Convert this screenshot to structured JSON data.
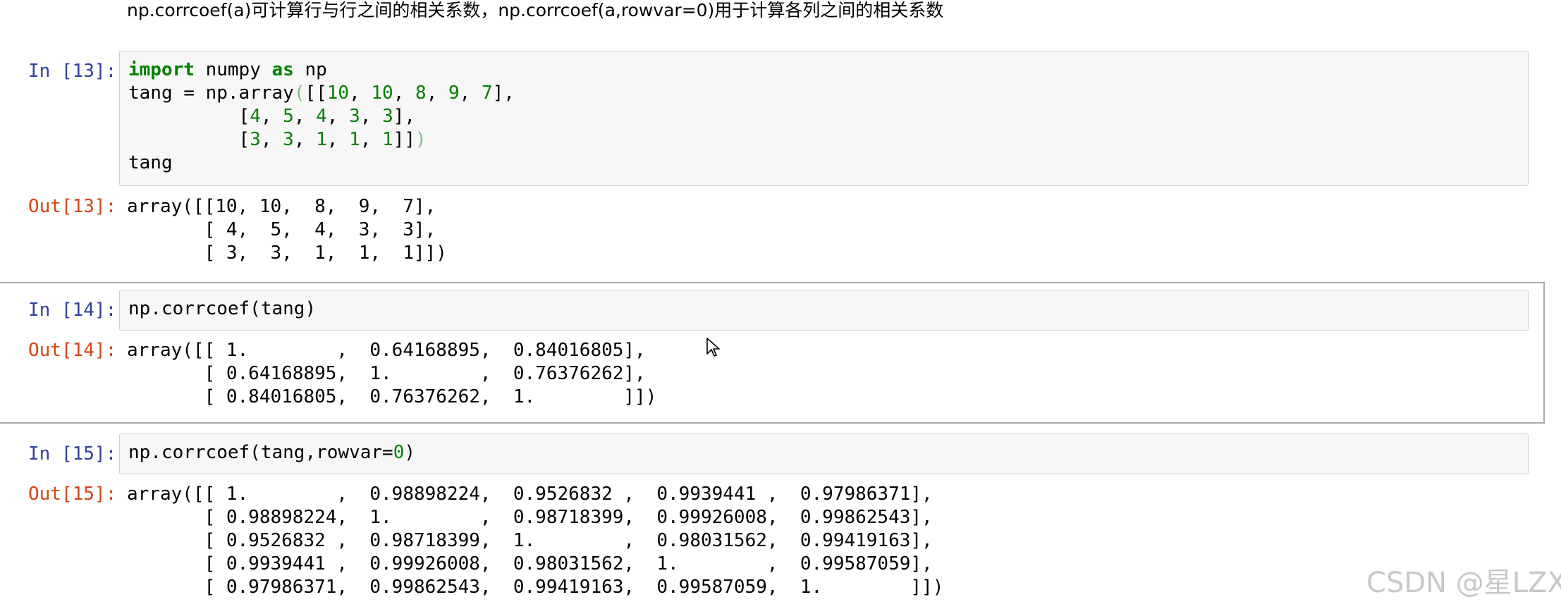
{
  "markdown": {
    "text": "np.corrcoef(a)可计算行与行之间的相关系数，np.corrcoef(a,rowvar=0)用于计算各列之间的相关系数"
  },
  "cells": [
    {
      "in_prompt": "In [13]:",
      "out_prompt": "Out[13]:",
      "input": {
        "line1_kw1": "import",
        "line1_mid": " numpy ",
        "line1_kw2": "as",
        "line1_end": " np",
        "line2_start": "tang = np.array",
        "line2_paren": "(",
        "line2_bracket": "[[",
        "row1_nums": [
          "10",
          "10",
          "8",
          "9",
          "7"
        ],
        "row2_nums": [
          "4",
          "5",
          "4",
          "3",
          "3"
        ],
        "row3_nums": [
          "3",
          "3",
          "1",
          "1",
          "1"
        ],
        "line5": "tang"
      },
      "output_lines": [
        "array([[10, 10,  8,  9,  7],",
        "       [ 4,  5,  4,  3,  3],",
        "       [ 3,  3,  1,  1,  1]])"
      ]
    },
    {
      "in_prompt": "In [14]:",
      "out_prompt": "Out[14]:",
      "input_code": "np.corrcoef(tang)",
      "output_lines": [
        "array([[ 1.        ,  0.64168895,  0.84016805],",
        "       [ 0.64168895,  1.        ,  0.76376262],",
        "       [ 0.84016805,  0.76376262,  1.        ]])"
      ]
    },
    {
      "in_prompt": "In [15]:",
      "out_prompt": "Out[15]:",
      "input_code_start": "np.corrcoef(tang,rowvar=",
      "input_code_num": "0",
      "input_code_end": ")",
      "output_lines": [
        "array([[ 1.        ,  0.98898224,  0.9526832 ,  0.9939441 ,  0.97986371],",
        "       [ 0.98898224,  1.        ,  0.98718399,  0.99926008,  0.99862543],",
        "       [ 0.9526832 ,  0.98718399,  1.        ,  0.98031562,  0.99419163],",
        "       [ 0.9939441 ,  0.99926008,  0.98031562,  1.        ,  0.99587059],",
        "       [ 0.97986371,  0.99862543,  0.99419163,  0.99587059,  1.        ]])"
      ]
    }
  ],
  "watermark": "CSDN @星LZX",
  "colors": {
    "in_prompt": "#303f9f",
    "out_prompt": "#d84315",
    "keyword": "#008000",
    "number": "#008000",
    "input_bg": "#f7f7f7"
  },
  "icons": {
    "cursor": "mouse-pointer-icon"
  }
}
